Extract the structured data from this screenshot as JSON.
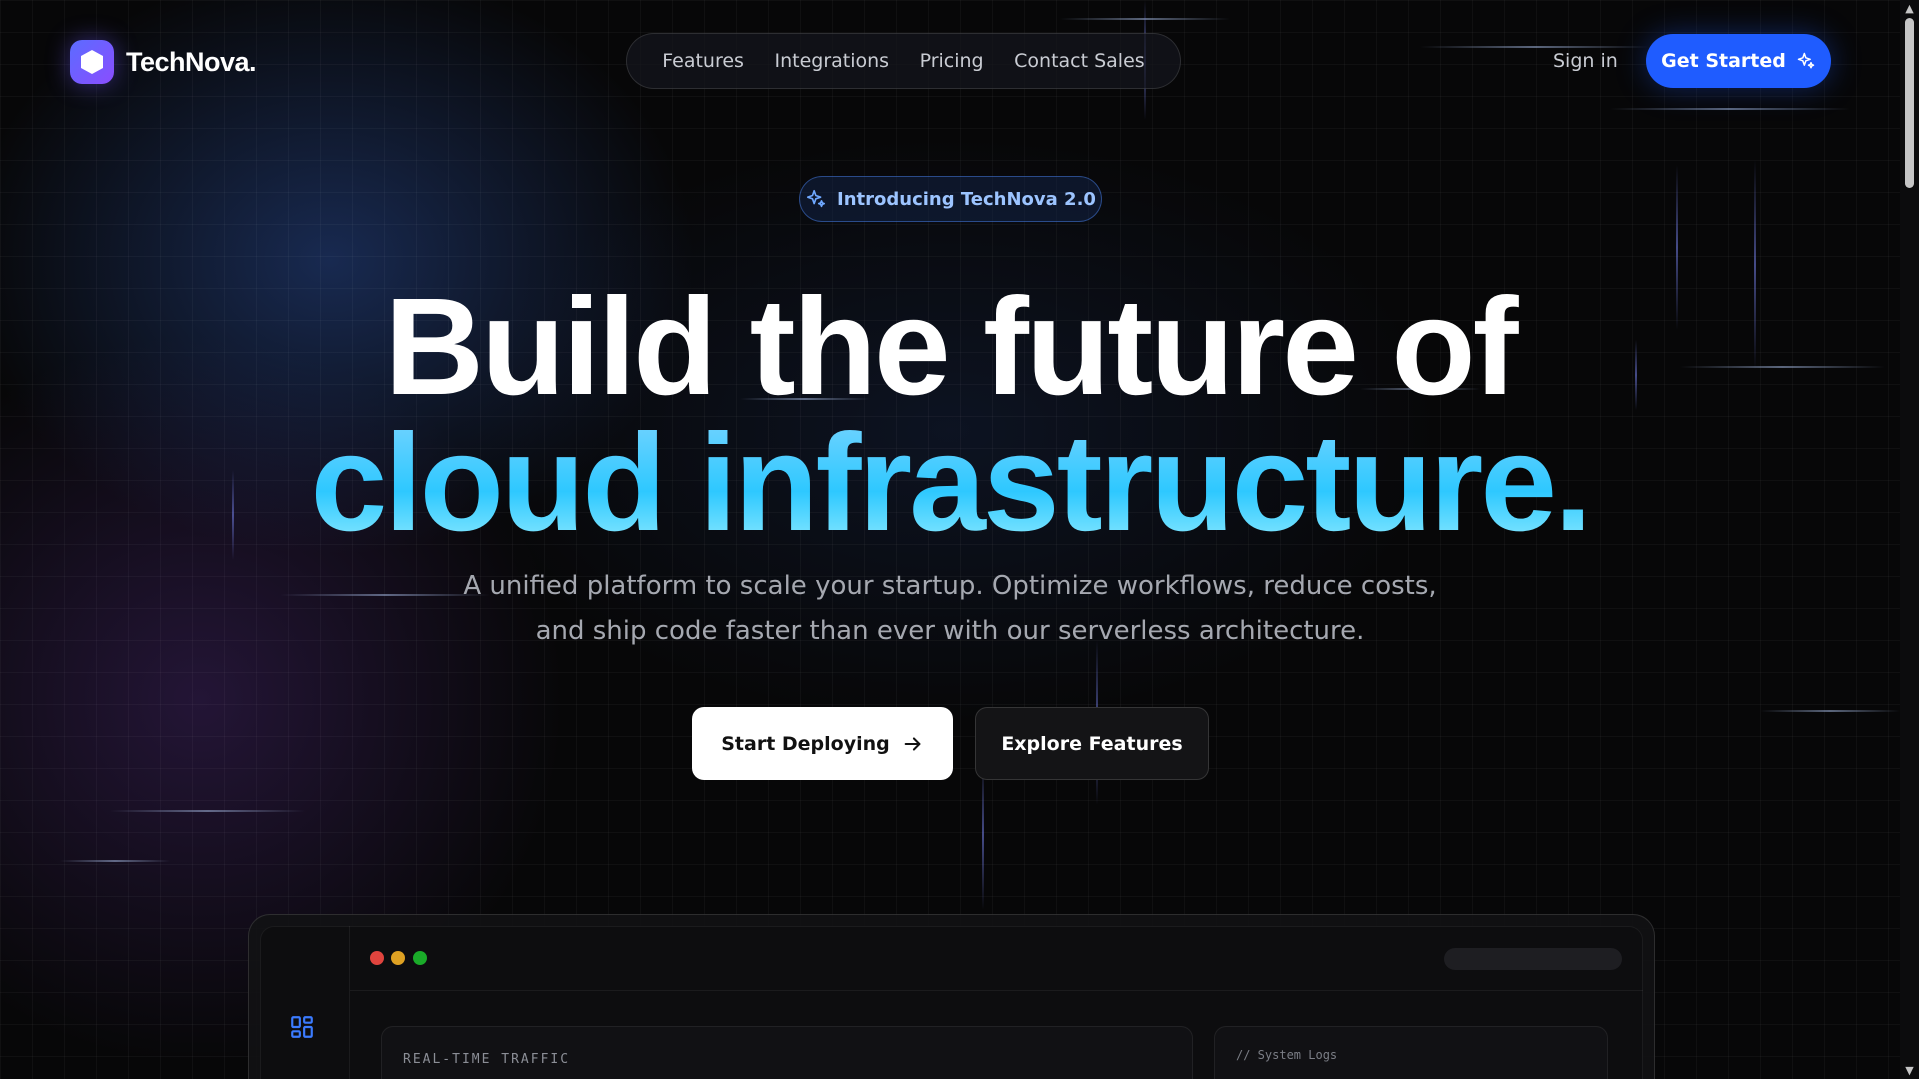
{
  "brand": {
    "name": "TechNova."
  },
  "nav": {
    "links": [
      "Features",
      "Integrations",
      "Pricing",
      "Contact Sales"
    ],
    "sign_in": "Sign in",
    "cta": "Get Started"
  },
  "hero": {
    "badge": "Introducing TechNova 2.0",
    "headline_line1": "Build the future of",
    "headline_line2": "cloud infrastructure.",
    "sub_line1": "A unified platform to scale your startup. Optimize workflows, reduce costs,",
    "sub_line2": "and ship code faster than ever with our serverless architecture.",
    "primary_button": "Start Deploying",
    "secondary_button": "Explore Features"
  },
  "preview": {
    "traffic_title": "REAL-TIME TRAFFIC",
    "logs_title": "// System Logs",
    "window_dots": [
      "#e0443e",
      "#dea123",
      "#1aab29"
    ]
  },
  "colors": {
    "accent": "#1f5cff",
    "headline_gradient": "#2ec8ff",
    "badge_text": "#9cc4ff"
  },
  "icons": [
    "hexagon-logo-icon",
    "sparkles-icon",
    "arrow-right-icon",
    "dashboard-grid-icon"
  ]
}
